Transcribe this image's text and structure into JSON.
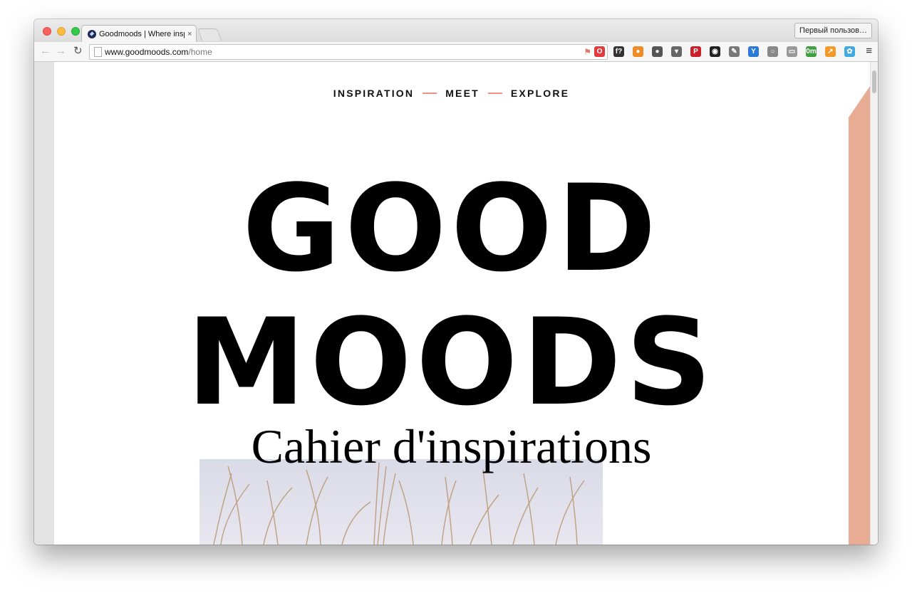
{
  "browser": {
    "tab_title": "Goodmoods | Where inspiration",
    "tab_close": "×",
    "profile_label": "Первый пользов…",
    "url_host": "www.goodmoods.com",
    "url_path": "/home",
    "back_icon": "←",
    "forward_icon": "→",
    "reload_icon": "↻",
    "star_icon": "☆",
    "menu_icon": "≡",
    "extensions": [
      {
        "name": "opera-icon",
        "glyph": "O",
        "color": "#e0393e"
      },
      {
        "name": "font-icon",
        "glyph": "f?",
        "color": "#333333"
      },
      {
        "name": "fire-icon",
        "glyph": "●",
        "color": "#f08a24"
      },
      {
        "name": "evernote-icon",
        "glyph": "●",
        "color": "#555555"
      },
      {
        "name": "pocket-icon",
        "glyph": "▾",
        "color": "#666666"
      },
      {
        "name": "pinterest-icon",
        "glyph": "P",
        "color": "#cb2027"
      },
      {
        "name": "lens-icon",
        "glyph": "◉",
        "color": "#222222"
      },
      {
        "name": "eyedropper-icon",
        "glyph": "✎",
        "color": "#777777"
      },
      {
        "name": "y-icon",
        "glyph": "Y",
        "color": "#2a7ad8"
      },
      {
        "name": "ring-icon",
        "glyph": "○",
        "color": "#888888"
      },
      {
        "name": "reader-icon",
        "glyph": "▭",
        "color": "#999999"
      },
      {
        "name": "timer-icon",
        "glyph": "0m",
        "color": "#3f9f3f"
      },
      {
        "name": "chart-icon",
        "glyph": "↗",
        "color": "#f29a27"
      },
      {
        "name": "puzzle-icon",
        "glyph": "✿",
        "color": "#3fa9e0"
      }
    ]
  },
  "site": {
    "nav": [
      "INSPIRATION",
      "MEET",
      "EXPLORE"
    ],
    "hero_line1": "GOOD",
    "hero_line2": "MOODS",
    "subtitle": "Cahier d'inspirations"
  },
  "colors": {
    "accent_pink": "#f08f88",
    "band_pink": "#e8ab93"
  }
}
